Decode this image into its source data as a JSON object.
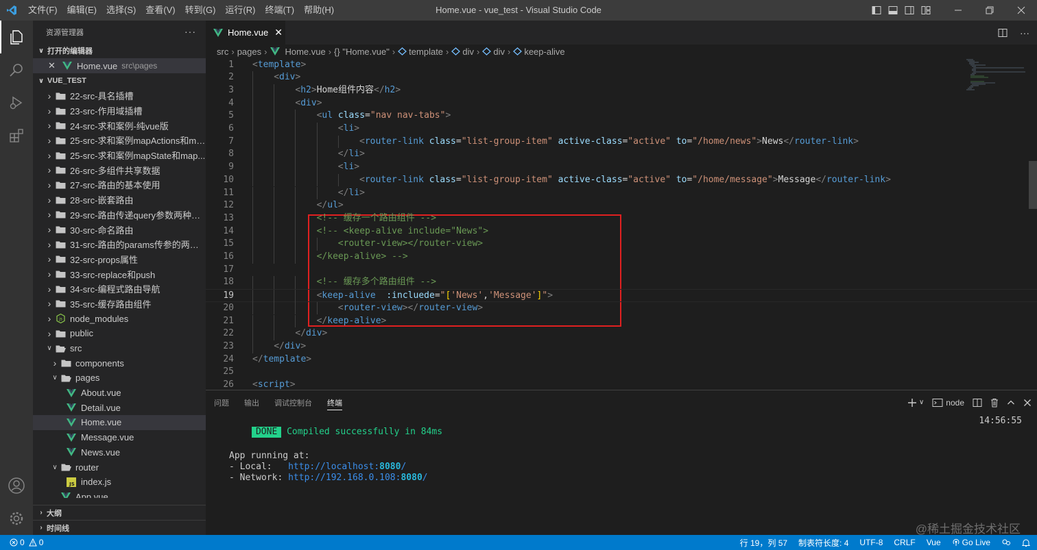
{
  "window": {
    "title": "Home.vue - vue_test - Visual Studio Code",
    "menu": [
      "文件(F)",
      "编辑(E)",
      "选择(S)",
      "查看(V)",
      "转到(G)",
      "运行(R)",
      "终端(T)",
      "帮助(H)"
    ]
  },
  "sidebar": {
    "header": "资源管理器",
    "more": "···",
    "open_editors_title": "打开的编辑器",
    "open_editor": {
      "name": "Home.vue",
      "path": "src\\pages"
    },
    "project_title": "VUE_TEST",
    "tree": [
      {
        "label": "22-src-具名插槽",
        "kind": "folder"
      },
      {
        "label": "23-src-作用域插槽",
        "kind": "folder"
      },
      {
        "label": "24-src-求和案例-纯vue版",
        "kind": "folder"
      },
      {
        "label": "25-src-求和案例mapActions和ma...",
        "kind": "folder"
      },
      {
        "label": "25-src-求和案例mapState和map...",
        "kind": "folder"
      },
      {
        "label": "26-src-多组件共享数据",
        "kind": "folder"
      },
      {
        "label": "27-src-路由的基本使用",
        "kind": "folder"
      },
      {
        "label": "28-src-嵌套路由",
        "kind": "folder"
      },
      {
        "label": "29-src-路由传递query参数两种方...",
        "kind": "folder"
      },
      {
        "label": "30-src-命名路由",
        "kind": "folder"
      },
      {
        "label": "31-src-路由的params传参的两种...",
        "kind": "folder"
      },
      {
        "label": "32-src-props属性",
        "kind": "folder"
      },
      {
        "label": "33-src-replace和push",
        "kind": "folder"
      },
      {
        "label": "34-src-编程式路由导航",
        "kind": "folder"
      },
      {
        "label": "35-src-缓存路由组件",
        "kind": "folder"
      },
      {
        "label": "node_modules",
        "kind": "node"
      },
      {
        "label": "public",
        "kind": "folder"
      },
      {
        "label": "src",
        "kind": "open"
      },
      {
        "label": "components",
        "kind": "folder",
        "depth": 1
      },
      {
        "label": "pages",
        "kind": "open",
        "depth": 1
      },
      {
        "label": "About.vue",
        "kind": "vue",
        "depth": 2
      },
      {
        "label": "Detail.vue",
        "kind": "vue",
        "depth": 2
      },
      {
        "label": "Home.vue",
        "kind": "vue",
        "depth": 2,
        "selected": true
      },
      {
        "label": "Message.vue",
        "kind": "vue",
        "depth": 2
      },
      {
        "label": "News.vue",
        "kind": "vue",
        "depth": 2
      },
      {
        "label": "router",
        "kind": "open",
        "depth": 1
      },
      {
        "label": "index.js",
        "kind": "js",
        "depth": 2
      },
      {
        "label": "App.vue",
        "kind": "vue",
        "depth": 1
      }
    ],
    "outline_title": "大纲",
    "timeline_title": "时间线"
  },
  "editor": {
    "tab": {
      "name": "Home.vue",
      "close": "✕"
    },
    "breadcrumb": [
      "src",
      "pages",
      "Home.vue",
      "{} \"Home.vue\"",
      "template",
      "div",
      "div",
      "keep-alive"
    ],
    "current_line": 19,
    "lines": [
      {
        "n": "1",
        "indent": 0,
        "html": "<span class='ptag'>&lt;</span><span class='tag'>template</span><span class='ptag'>&gt;</span>"
      },
      {
        "n": "2",
        "indent": 1,
        "html": "<span class='ptag'>&lt;</span><span class='tag'>div</span><span class='ptag'>&gt;</span>"
      },
      {
        "n": "3",
        "indent": 2,
        "html": "<span class='ptag'>&lt;</span><span class='tag'>h2</span><span class='ptag'>&gt;</span><span class='txt'>Home组件内容</span><span class='ptag'>&lt;/</span><span class='tag'>h2</span><span class='ptag'>&gt;</span>"
      },
      {
        "n": "4",
        "indent": 2,
        "html": "<span class='ptag'>&lt;</span><span class='tag'>div</span><span class='ptag'>&gt;</span>"
      },
      {
        "n": "5",
        "indent": 3,
        "html": "<span class='ptag'>&lt;</span><span class='tag'>ul</span> <span class='att'>class</span><span class='txt'>=</span><span class='str'>\"nav nav-tabs\"</span><span class='ptag'>&gt;</span>"
      },
      {
        "n": "6",
        "indent": 4,
        "html": "<span class='ptag'>&lt;</span><span class='tag'>li</span><span class='ptag'>&gt;</span>"
      },
      {
        "n": "7",
        "indent": 5,
        "html": "<span class='ptag'>&lt;</span><span class='tag'>router-link</span> <span class='att'>class</span><span class='txt'>=</span><span class='str'>\"list-group-item\"</span> <span class='att'>active-class</span><span class='txt'>=</span><span class='str'>\"active\"</span> <span class='att'>to</span><span class='txt'>=</span><span class='str'>\"/home/news\"</span><span class='ptag'>&gt;</span><span class='txt'>News</span><span class='ptag'>&lt;/</span><span class='tag'>router-link</span><span class='ptag'>&gt;</span>"
      },
      {
        "n": "8",
        "indent": 4,
        "html": "<span class='ptag'>&lt;/</span><span class='tag'>li</span><span class='ptag'>&gt;</span>"
      },
      {
        "n": "9",
        "indent": 4,
        "html": "<span class='ptag'>&lt;</span><span class='tag'>li</span><span class='ptag'>&gt;</span>"
      },
      {
        "n": "10",
        "indent": 5,
        "html": "<span class='ptag'>&lt;</span><span class='tag'>router-link</span> <span class='att'>class</span><span class='txt'>=</span><span class='str'>\"list-group-item\"</span> <span class='att'>active-class</span><span class='txt'>=</span><span class='str'>\"active\"</span> <span class='att'>to</span><span class='txt'>=</span><span class='str'>\"/home/message\"</span><span class='ptag'>&gt;</span><span class='txt'>Message</span><span class='ptag'>&lt;/</span><span class='tag'>router-link</span><span class='ptag'>&gt;</span>"
      },
      {
        "n": "11",
        "indent": 4,
        "html": "<span class='ptag'>&lt;/</span><span class='tag'>li</span><span class='ptag'>&gt;</span>"
      },
      {
        "n": "12",
        "indent": 3,
        "html": "<span class='ptag'>&lt;/</span><span class='tag'>ul</span><span class='ptag'>&gt;</span>"
      },
      {
        "n": "13",
        "indent": 3,
        "html": "<span class='cm'>&lt;!-- 缓存一个路由组件 --&gt;</span>"
      },
      {
        "n": "14",
        "indent": 3,
        "html": "<span class='cm'>&lt;!-- &lt;keep-alive include=\"News\"&gt;</span>"
      },
      {
        "n": "15",
        "indent": 4,
        "html": "<span class='cm'>&lt;router-view&gt;&lt;/router-view&gt;</span>"
      },
      {
        "n": "16",
        "indent": 3,
        "html": "<span class='cm'>&lt;/keep-alive&gt; --&gt;</span>"
      },
      {
        "n": "17",
        "indent": 0,
        "html": ""
      },
      {
        "n": "18",
        "indent": 3,
        "html": "<span class='cm'>&lt;!-- 缓存多个路由组件 --&gt;</span>"
      },
      {
        "n": "19",
        "indent": 3,
        "html": "<span class='ptag'>&lt;</span><span class='tag'>keep-alive</span>  <span class='att'>:incluede</span><span class='txt'>=</span><span class='str'>\"</span><span class='br'>[</span><span class='str'>'News'</span><span class='txt'>,</span><span class='str'>'Message'</span><span class='br'>]</span><span class='str'>\"</span><span class='ptag'>&gt;</span>"
      },
      {
        "n": "20",
        "indent": 4,
        "html": "<span class='ptag'>&lt;</span><span class='tag'>router-view</span><span class='ptag'>&gt;&lt;/</span><span class='tag'>router-view</span><span class='ptag'>&gt;</span>"
      },
      {
        "n": "21",
        "indent": 3,
        "html": "<span class='ptag'>&lt;/</span><span class='tag'>keep-alive</span><span class='ptag'>&gt;</span>"
      },
      {
        "n": "22",
        "indent": 2,
        "html": "<span class='ptag'>&lt;/</span><span class='tag'>div</span><span class='ptag'>&gt;</span>"
      },
      {
        "n": "23",
        "indent": 1,
        "html": "<span class='ptag'>&lt;/</span><span class='tag'>div</span><span class='ptag'>&gt;</span>"
      },
      {
        "n": "24",
        "indent": 0,
        "html": "<span class='ptag'>&lt;/</span><span class='tag'>template</span><span class='ptag'>&gt;</span>"
      },
      {
        "n": "25",
        "indent": 0,
        "html": ""
      },
      {
        "n": "26",
        "indent": 0,
        "html": "<span class='ptag'>&lt;</span><span class='tag'>script</span><span class='ptag'>&gt;</span>"
      }
    ]
  },
  "panel": {
    "tabs": [
      "问题",
      "输出",
      "调试控制台",
      "终端"
    ],
    "active_tab": "终端",
    "terminal_name": "node",
    "timestamp": "14:56:55",
    "done_badge": "DONE",
    "compiled": "Compiled successfully in 84ms",
    "app_running": "App running at:",
    "local_label": "- Local:   ",
    "local_url": "http://localhost:",
    "local_port": "8080",
    "network_label": "- Network: ",
    "network_url": "http://192.168.0.108:",
    "network_port": "8080",
    "slash": "/",
    "watermark": "@稀土掘金技术社区"
  },
  "statusbar": {
    "errors": "0",
    "warnings": "0",
    "position": "行 19，列 57",
    "tab_size": "制表符长度: 4",
    "encoding": "UTF-8",
    "eol": "CRLF",
    "language": "Vue",
    "go_live": "Go Live"
  },
  "colors": {
    "accent": "#007acc",
    "highlight_box": "#e02020",
    "vue_icon": "#41b883"
  }
}
